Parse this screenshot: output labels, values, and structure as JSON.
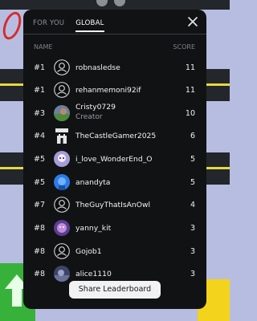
{
  "tabs": [
    {
      "label": "FOR YOU",
      "active": false
    },
    {
      "label": "GLOBAL",
      "active": true
    }
  ],
  "columns": {
    "name": "NAME",
    "score": "SCORE"
  },
  "rows": [
    {
      "rank": "#1",
      "name": "robnasledse",
      "sub": "",
      "score": "11",
      "avatar": "default-avatar-icon"
    },
    {
      "rank": "#1",
      "name": "rehanmemoni92if",
      "sub": "",
      "score": "11",
      "avatar": "default-avatar-icon"
    },
    {
      "rank": "#3",
      "name": "Cristy0729",
      "sub": "Creator",
      "score": "10",
      "avatar": "photo-avatar"
    },
    {
      "rank": "#4",
      "name": "TheCastleGamer2025",
      "sub": "",
      "score": "6",
      "avatar": "castle-logo-avatar"
    },
    {
      "rank": "#5",
      "name": "i_love_WonderEnd_O",
      "sub": "",
      "score": "5",
      "avatar": "character-avatar"
    },
    {
      "rank": "#5",
      "name": "anandyta",
      "sub": "",
      "score": "5",
      "avatar": "blue-character-avatar"
    },
    {
      "rank": "#7",
      "name": "TheGuyThatIsAnOwl",
      "sub": "",
      "score": "4",
      "avatar": "default-avatar-icon"
    },
    {
      "rank": "#8",
      "name": "yanny_kit",
      "sub": "",
      "score": "3",
      "avatar": "purple-character-avatar"
    },
    {
      "rank": "#8",
      "name": "Gojob1",
      "sub": "",
      "score": "3",
      "avatar": "default-avatar-icon"
    },
    {
      "rank": "#8",
      "name": "alice1110",
      "sub": "",
      "score": "3",
      "avatar": "photo-avatar"
    }
  ],
  "share_label": "Share Leaderboard",
  "colors": {
    "panel": "#111214",
    "background": "#b7bde0",
    "button": "#f2f2f4"
  }
}
